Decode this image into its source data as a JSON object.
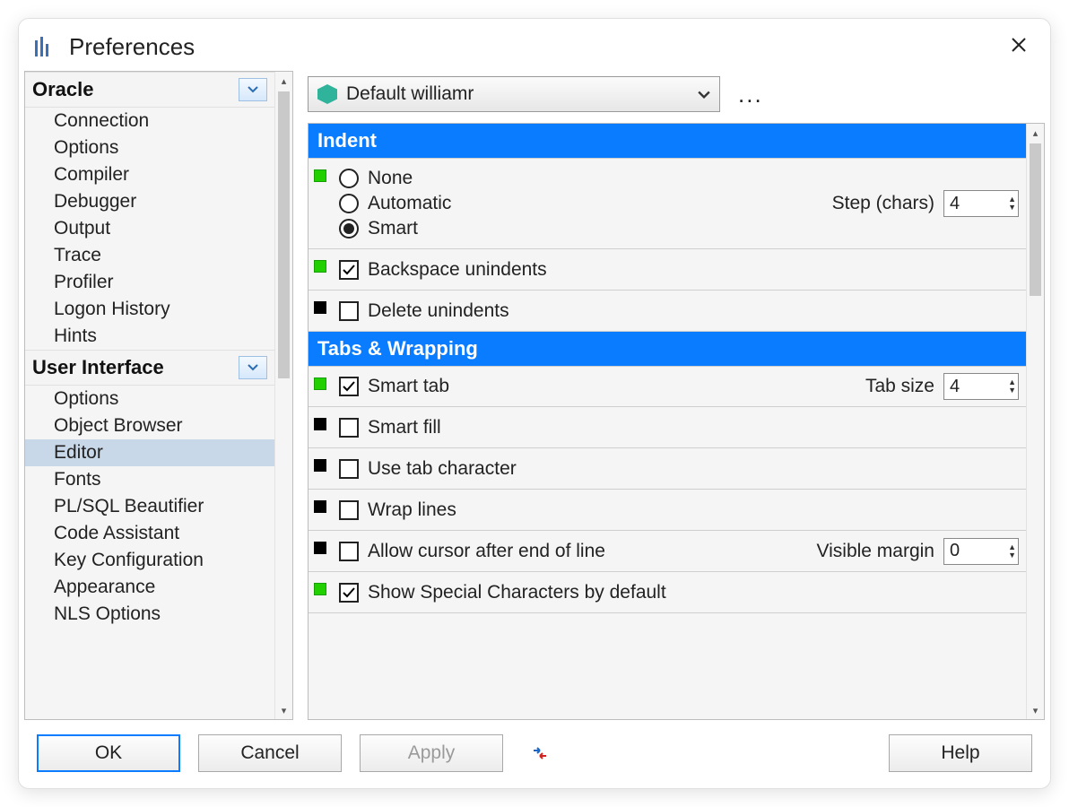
{
  "window": {
    "title": "Preferences"
  },
  "sidebar": {
    "categories": [
      {
        "label": "Oracle",
        "items": [
          "Connection",
          "Options",
          "Compiler",
          "Debugger",
          "Output",
          "Trace",
          "Profiler",
          "Logon History",
          "Hints"
        ]
      },
      {
        "label": "User Interface",
        "items": [
          "Options",
          "Object Browser",
          "Editor",
          "Fonts",
          "PL/SQL Beautifier",
          "Code Assistant",
          "Key Configuration",
          "Appearance",
          "NLS Options"
        ],
        "selected": "Editor"
      }
    ]
  },
  "main": {
    "profile": {
      "selected": "Default williamr",
      "more": "..."
    },
    "sections": [
      {
        "title": "Indent",
        "radios": [
          "None",
          "Automatic",
          "Smart"
        ],
        "radio_selected": "Smart",
        "step_label": "Step (chars)",
        "step_value": "4",
        "checks": [
          "Backspace unindents",
          "Delete unindents"
        ],
        "checks_state": [
          true,
          false
        ],
        "markers": [
          "green",
          "green",
          "black"
        ]
      },
      {
        "title": "Tabs & Wrapping",
        "rows": [
          {
            "label": "Smart tab",
            "checked": true,
            "marker": "green",
            "field_label": "Tab size",
            "field_value": "4"
          },
          {
            "label": "Smart fill",
            "checked": false,
            "marker": "black"
          },
          {
            "label": "Use tab character",
            "checked": false,
            "marker": "black"
          },
          {
            "label": "Wrap lines",
            "checked": false,
            "marker": "black"
          },
          {
            "label": "Allow cursor after end of line",
            "checked": false,
            "marker": "black",
            "field_label": "Visible margin",
            "field_value": "0"
          },
          {
            "label": "Show Special Characters by default",
            "checked": true,
            "marker": "green"
          }
        ]
      }
    ]
  },
  "footer": {
    "ok": "OK",
    "cancel": "Cancel",
    "apply": "Apply",
    "help": "Help"
  },
  "colors": {
    "accent": "#0a7cff",
    "marker_green": "#22d000",
    "marker_black": "#000000",
    "selection": "#c9d8e8"
  }
}
